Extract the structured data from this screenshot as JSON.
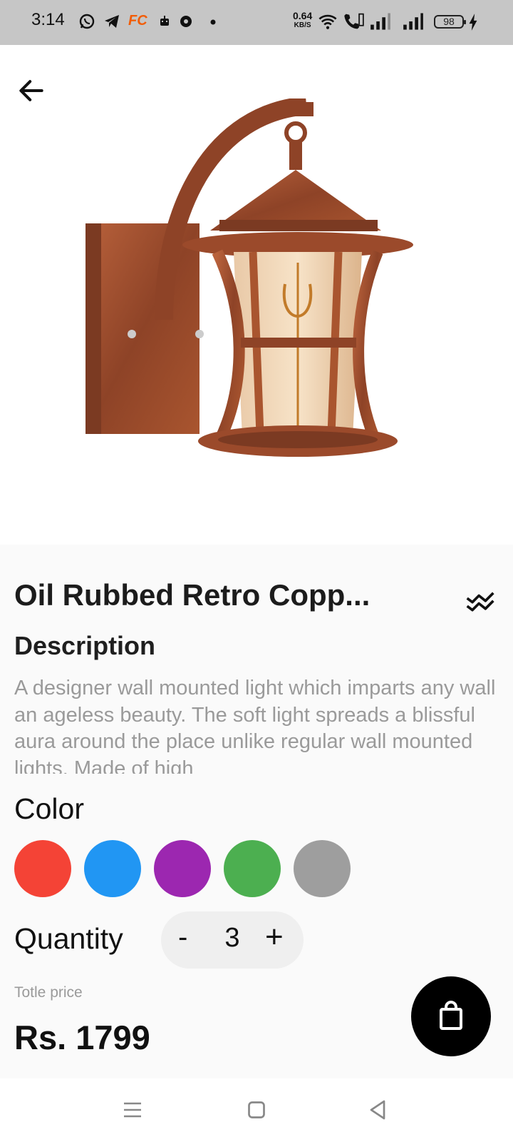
{
  "status_bar": {
    "time": "3:14",
    "net_speed": "0.64",
    "net_unit": "KB/S",
    "battery": "98",
    "icons": [
      "whatsapp-icon",
      "telegram-icon",
      "fc-app-icon",
      "robot-icon",
      "chrome-icon",
      "dot-icon",
      "wifi-icon",
      "volte-call-icon",
      "signal-icon",
      "signal-icon",
      "charging-icon"
    ],
    "fc_label": "FC"
  },
  "product": {
    "title": "Oil Rubbed Retro Copp...",
    "description_heading": "Description",
    "description": "A designer wall mounted light which imparts any wall an ageless beauty. The soft light spreads a blissful aura around the place unlike regular wall mounted lights. Made of high",
    "color_heading": "Color",
    "colors": [
      {
        "name": "red",
        "hex": "#f44336"
      },
      {
        "name": "blue",
        "hex": "#2196f3"
      },
      {
        "name": "purple",
        "hex": "#9c27b0"
      },
      {
        "name": "green",
        "hex": "#4caf50"
      },
      {
        "name": "grey",
        "hex": "#9e9e9e"
      }
    ],
    "quantity_label": "Quantity",
    "quantity": {
      "minus": "-",
      "value": "3",
      "plus": "+"
    },
    "price_label": "Totle price",
    "price": "Rs. 1799"
  },
  "theme": {
    "accent": "#000000",
    "background": "#fafafa",
    "copper": "#a1502e"
  }
}
